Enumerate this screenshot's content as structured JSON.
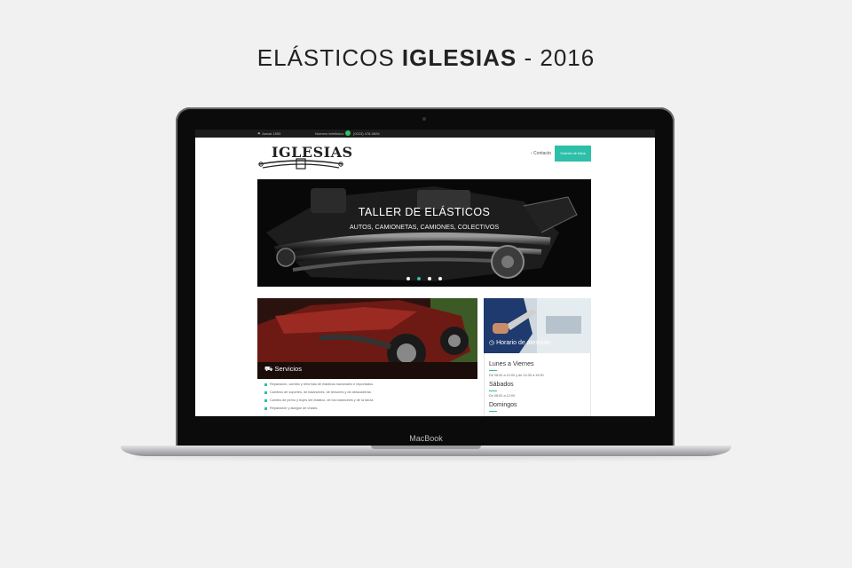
{
  "headline": {
    "part1": "ELÁSTICOS ",
    "brand": "IGLESIAS",
    "part2": " - 2016"
  },
  "device": {
    "label": "MacBook"
  },
  "site": {
    "topbar": {
      "location": "Juncal 1553",
      "phone_label": "Número telefónico",
      "phone": "(0223) 478-9826"
    },
    "logo_text": "IGLESIAS",
    "nav": {
      "contact": "‹ Contacto",
      "gallery": "Galería de fotos"
    },
    "hero": {
      "title": "TALLER DE ELÁSTICOS",
      "subtitle": "AUTOS, CAMIONETAS, CAMIONES, COLECTIVOS",
      "slides": 4,
      "active_slide": 2
    },
    "services": {
      "title": "Servicios",
      "items": [
        "Reparación, cambio y reformas de elásticos nacionales e importados.",
        "Cambios de soportes, de balancines, de tensores y de abrazaderas.",
        "Cambio de perno y bujes del elástico, de los balancines y de la tanza.",
        "Reparación y alargue de chasis."
      ]
    },
    "schedule": {
      "title": "Horario de atención",
      "days": [
        {
          "name": "Lunes a Viernes",
          "hours": "De 08:00 a 12:00 y de 14:30 a 19:30"
        },
        {
          "name": "Sábados",
          "hours": "De 08:00 a 12:00"
        },
        {
          "name": "Domingos",
          "hours": ""
        }
      ]
    },
    "accent_color": "#2ebfa8"
  }
}
